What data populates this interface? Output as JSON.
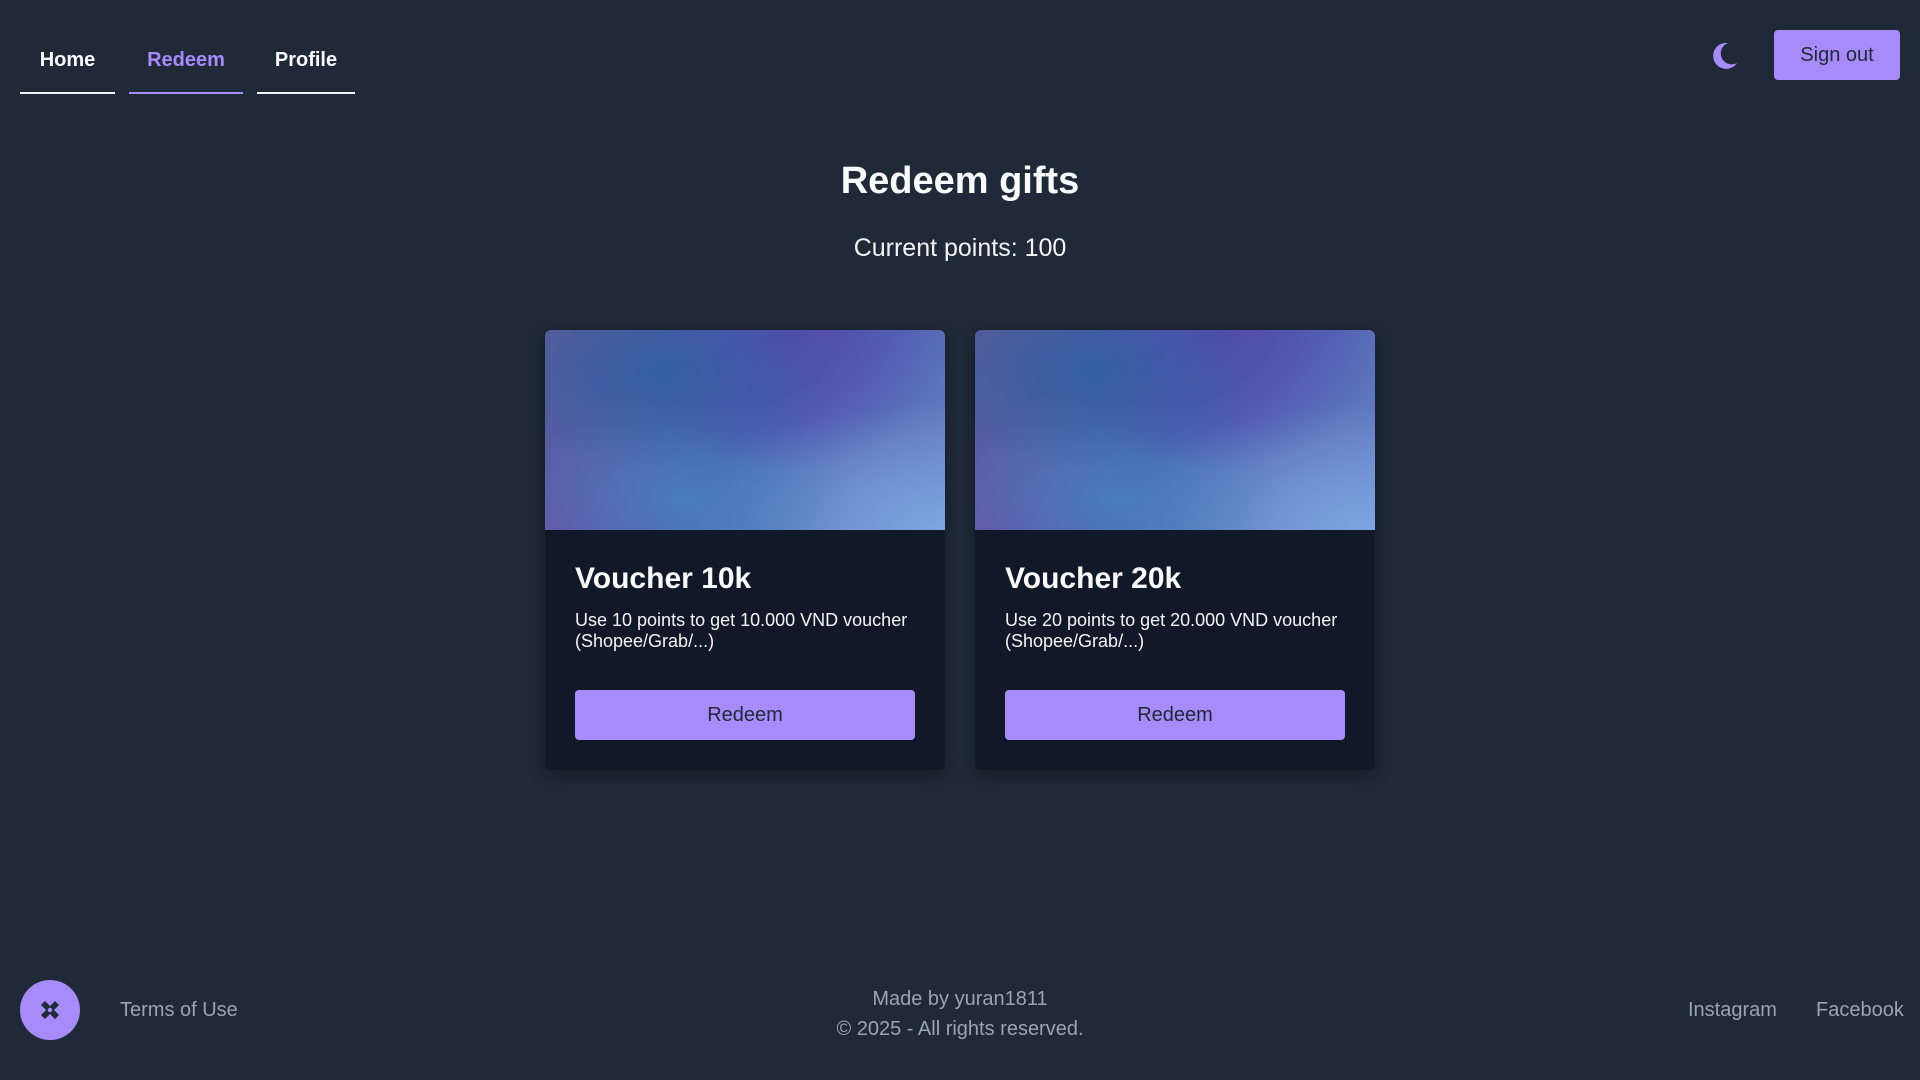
{
  "nav": {
    "tabs": [
      {
        "label": "Home",
        "active": false
      },
      {
        "label": "Redeem",
        "active": true
      },
      {
        "label": "Profile",
        "active": false
      }
    ]
  },
  "header": {
    "theme_toggle_icon": "moon-icon",
    "signout_label": "Sign out"
  },
  "main": {
    "title": "Redeem gifts",
    "points_text": "Current points: 100"
  },
  "cards": [
    {
      "title": "Voucher 10k",
      "description": "Use 10 points to get 10.000 VND voucher (Shopee/Grab/...)",
      "button_label": "Redeem"
    },
    {
      "title": "Voucher 20k",
      "description": "Use 20 points to get 20.000 VND voucher (Shopee/Grab/...)",
      "button_label": "Redeem"
    }
  ],
  "footer": {
    "logo_icon": "x-logo-icon",
    "terms_label": "Terms of Use",
    "made_by": "Made by yuran1811",
    "copyright": "© 2025 - All rights reserved.",
    "instagram_label": "Instagram",
    "facebook_label": "Facebook"
  },
  "colors": {
    "background": "#1f2937",
    "card_background": "#111827",
    "accent": "#a78bfa",
    "muted_text": "#9ca3af"
  }
}
